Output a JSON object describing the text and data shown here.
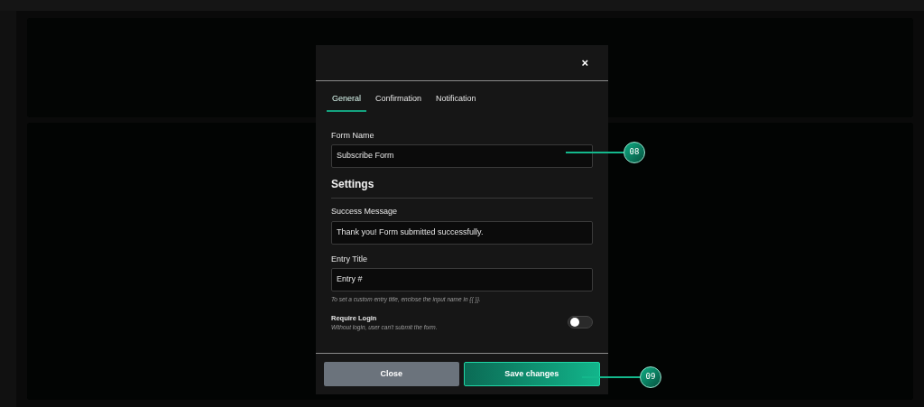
{
  "modal": {
    "close_icon": "×",
    "tabs": [
      {
        "label": "General",
        "selected": true
      },
      {
        "label": "Confirmation",
        "selected": false
      },
      {
        "label": "Notification",
        "selected": false
      }
    ],
    "form_name": {
      "label": "Form Name",
      "value": "Subscribe Form"
    },
    "settings_heading": "Settings",
    "success_message": {
      "label": "Success Message",
      "value": "Thank you! Form submitted successfully."
    },
    "entry_title": {
      "label": "Entry Title",
      "value": "Entry #",
      "hint": "To set a custom entry title, enclose the input name in {{ }}."
    },
    "require_login": {
      "label": "Require Login",
      "description": "Without login, user can't submit the form.",
      "on": false
    },
    "buttons": [
      {
        "kind": "secondary",
        "label": "Close"
      },
      {
        "kind": "primary",
        "label": "Save changes"
      }
    ]
  },
  "callouts": [
    {
      "label": "08"
    },
    {
      "label": "09"
    }
  ]
}
